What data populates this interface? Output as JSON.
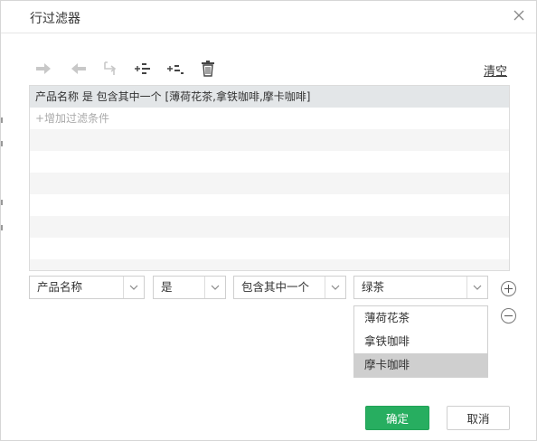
{
  "dialog": {
    "title": "行过滤器",
    "close_icon": "close-icon"
  },
  "toolbar": {
    "icons": [
      "arrow-right-icon",
      "arrow-left-icon",
      "swap-icon",
      "add-condition-icon",
      "add-subcondition-icon",
      "trash-icon"
    ],
    "clear_label": "清空"
  },
  "filter_list": {
    "rows": [
      "产品名称 是 包含其中一个 [薄荷花茶,拿铁咖啡,摩卡咖啡]",
      "+增加过滤条件"
    ]
  },
  "editor": {
    "field": "产品名称",
    "operator_is": "是",
    "operator_match": "包含其中一个",
    "value": "绿茶"
  },
  "dropdown": {
    "options": [
      "薄荷花茶",
      "拿铁咖啡",
      "摩卡咖啡"
    ],
    "highlighted_index": 2
  },
  "footer": {
    "ok_label": "确定",
    "cancel_label": "取消"
  },
  "colors": {
    "ok_button": "#27ae60",
    "selected_row": "#e3e6e8",
    "highlighted_option": "#cfcfcf"
  }
}
